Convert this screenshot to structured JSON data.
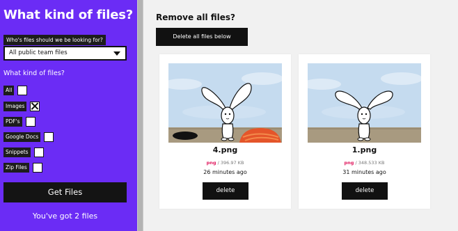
{
  "sidebar": {
    "title": "What kind of files?",
    "who_label": "Who's files should we be looking for?",
    "who_select_value": "All public team files",
    "kinds_label": "What kind of files?",
    "options": [
      {
        "label": "All",
        "checked": false
      },
      {
        "label": "Images",
        "checked": true
      },
      {
        "label": "PDF's",
        "checked": false
      },
      {
        "label": "Google Docs",
        "checked": false
      },
      {
        "label": "Snippets",
        "checked": false
      },
      {
        "label": "Zip Files",
        "checked": false
      }
    ],
    "get_button": "Get Files",
    "count_text": "You've got 2 files",
    "accent": "#6b2cf5"
  },
  "main": {
    "title": "Remove all files?",
    "delete_all_label": "Delete all files below",
    "files": [
      {
        "name": "4.png",
        "ext": "png",
        "size": "/ 396.97 KB",
        "time": "26 minutes ago",
        "delete_label": "delete"
      },
      {
        "name": "1.png",
        "ext": "png",
        "size": "/ 348.533 KB",
        "time": "31 minutes ago",
        "delete_label": "delete"
      }
    ]
  }
}
